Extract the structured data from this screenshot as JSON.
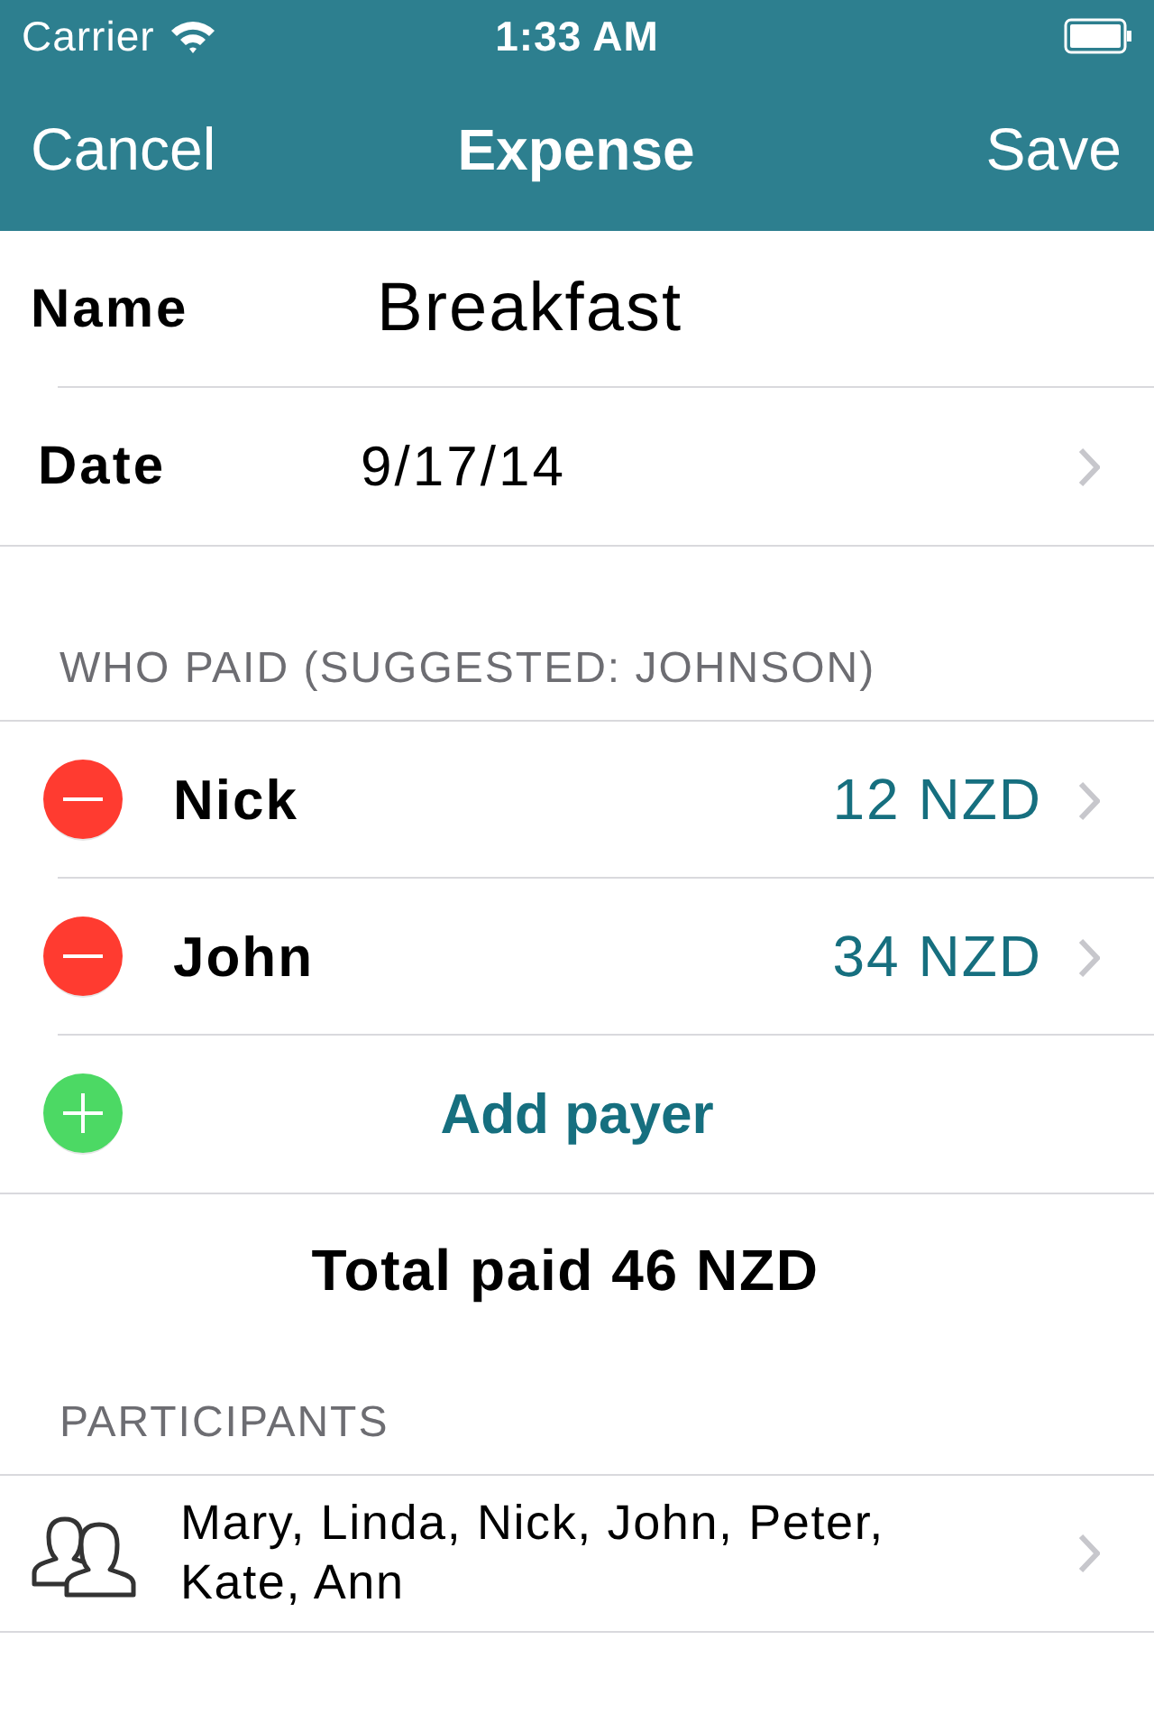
{
  "status_bar": {
    "carrier": "Carrier",
    "time": "1:33 AM"
  },
  "nav_bar": {
    "left_button": "Cancel",
    "title": "Expense",
    "right_button": "Save"
  },
  "fields": [
    {
      "kind": "text",
      "label": "Name",
      "value": "Breakfast"
    },
    {
      "kind": "disclosure",
      "label": "Date",
      "value": "9/17/14"
    }
  ],
  "payers": {
    "header": "WHO PAID (SUGGESTED: JOHNSON)",
    "rows": [
      {
        "name": "Nick",
        "amount": "12 NZD"
      },
      {
        "name": "John",
        "amount": "34 NZD"
      }
    ],
    "add_label": "Add payer",
    "total": "Total paid 46 NZD"
  },
  "participants": {
    "header": "PARTICIPANTS",
    "names": "Mary, Linda, Nick, John, Peter, Kate, Ann"
  }
}
